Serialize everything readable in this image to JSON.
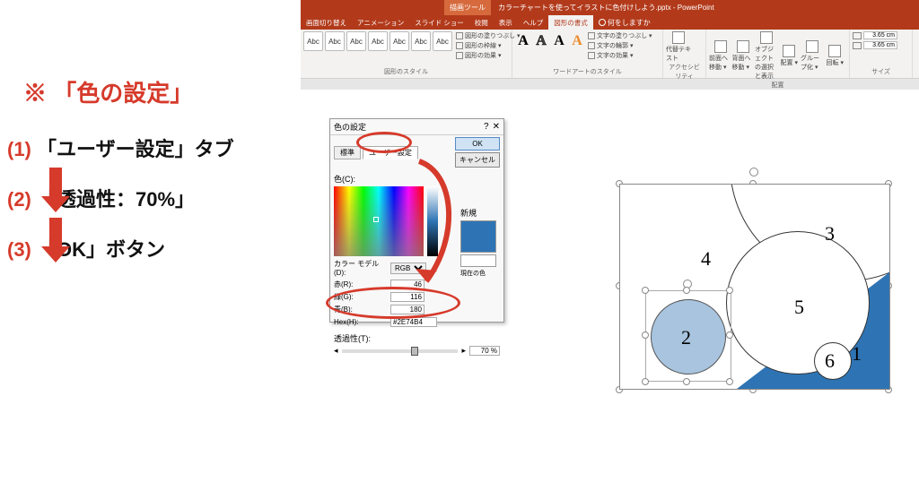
{
  "app": {
    "context_tab": "描画ツール",
    "doc_title": "カラーチャートを使ってイラストに色付けしよう.pptx - PowerPoint"
  },
  "ribbon": {
    "tabs": [
      "画面切り替え",
      "アニメーション",
      "スライド ショー",
      "校閲",
      "表示",
      "ヘルプ"
    ],
    "active_tab": "図形の書式",
    "search_prompt": "何をしますか",
    "groups": {
      "shape_styles": {
        "label": "図形のスタイル",
        "sample": "Abc",
        "fill": "図形の塗りつぶし ▾",
        "outline": "図形の枠線 ▾",
        "effects": "図形の効果 ▾"
      },
      "wordart": {
        "label": "ワードアートのスタイル",
        "text_fill": "文字の塗りつぶし ▾",
        "text_outline": "文字の輪郭 ▾",
        "text_effects": "文字の効果 ▾"
      },
      "accessibility": {
        "label": "アクセシビリティ",
        "alt": "代替テキスト"
      },
      "arrange": {
        "label": "配置",
        "front": "前面へ移動 ▾",
        "back": "背面へ移動 ▾",
        "sel": "オブジェクトの選択と表示",
        "align": "配置 ▾",
        "group": "グループ化 ▾",
        "rotate": "回転 ▾"
      },
      "size": {
        "label": "サイズ",
        "height": "3.65 cm",
        "width": "3.65 cm"
      }
    }
  },
  "instructions": {
    "title": "※ 「色の設定」",
    "step1_prefix": "(1)",
    "step1": "「ユーザー設定」タブ",
    "step2_prefix": "(2)",
    "step2": "「透過性：70%」",
    "step3_prefix": "(3)",
    "step3": "「OK」ボタン"
  },
  "dialog": {
    "title": "色の設定",
    "tab_standard": "標準",
    "tab_custom": "ユーザー設定",
    "ok": "OK",
    "cancel": "キャンセル",
    "colors_label": "色(C):",
    "model_label": "カラー モデル(D):",
    "model_value": "RGB",
    "r_label": "赤(R):",
    "r_value": "46",
    "g_label": "緑(G):",
    "g_value": "116",
    "b_label": "青(B):",
    "b_value": "180",
    "hex_label": "Hex(H):",
    "hex_value": "#2E74B4",
    "new_label": "新規",
    "current_label": "現在の色",
    "transparency_label": "透過性(T):",
    "transparency_value": "70 %",
    "color": "#2E74B4"
  },
  "canvas": {
    "numbers": {
      "1": "1",
      "2": "2",
      "3": "3",
      "4": "4",
      "5": "5",
      "6": "6"
    }
  },
  "colors": {
    "ribbon": "#b23a1b",
    "accent_red": "#d63a2b",
    "swatch": "#2E74B4",
    "circle_blue": "#a8c4de"
  }
}
